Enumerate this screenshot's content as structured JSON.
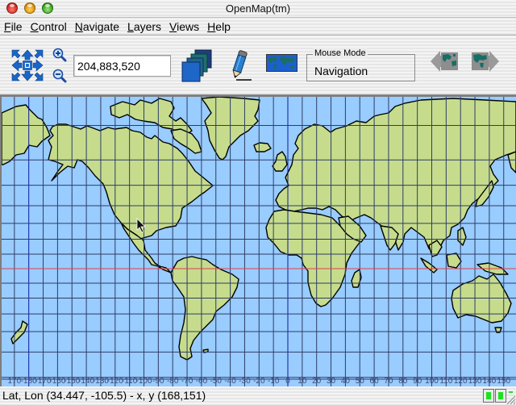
{
  "window": {
    "title": "OpenMap(tm)",
    "controls": [
      "close",
      "minimize",
      "zoom"
    ]
  },
  "menubar": {
    "items": [
      {
        "label": "File",
        "mnemonic": "F",
        "rest": "ile"
      },
      {
        "label": "Control",
        "mnemonic": "C",
        "rest": "ontrol"
      },
      {
        "label": "Navigate",
        "mnemonic": "N",
        "rest": "avigate"
      },
      {
        "label": "Layers",
        "mnemonic": "L",
        "rest": "ayers"
      },
      {
        "label": "Views",
        "mnemonic": "V",
        "rest": "iews"
      },
      {
        "label": "Help",
        "mnemonic": "H",
        "rest": "elp"
      }
    ]
  },
  "toolbar": {
    "pan_control_icon": "pan-arrows-icon",
    "zoom_in_icon": "zoom-in-icon",
    "zoom_out_icon": "zoom-out-icon",
    "scale_value": "204,883,520",
    "layers_icon": "layers-stack-icon",
    "drawing_tool_icon": "pencil-icon",
    "overview_map_icon": "world-map-icon",
    "mouse_mode": {
      "legend": "Mouse Mode",
      "value": "Navigation"
    },
    "nav_back_icon": "projection-back-icon",
    "nav_forward_icon": "projection-forward-icon"
  },
  "map": {
    "projection": "Mercator",
    "colors": {
      "ocean": "#99ccff",
      "land": "#c6dc8c",
      "coastline": "#000000",
      "graticule": "#2e3d66",
      "dateline_meridian": "#0a1aa0",
      "equator": "#e0404a"
    },
    "graticule_step_degrees": 10,
    "longitude_labels": [
      "170",
      "-180",
      "-170",
      "-160",
      "-150",
      "-140",
      "-130",
      "-120",
      "-110",
      "-100",
      "-90",
      "-80",
      "-70",
      "-60",
      "-50",
      "-40",
      "-30",
      "-20",
      "-10",
      "0",
      "10",
      "20",
      "30",
      "40",
      "50",
      "60",
      "70",
      "80",
      "90",
      "100",
      "110",
      "120",
      "130",
      "140",
      "150"
    ]
  },
  "statusbar": {
    "text": "Lat, Lon (34.447, -105.5) - x, y (168,151)",
    "indicators": [
      {
        "name": "indicator-1",
        "color": "#21e021"
      },
      {
        "name": "indicator-2",
        "color": "#21e021"
      }
    ]
  }
}
